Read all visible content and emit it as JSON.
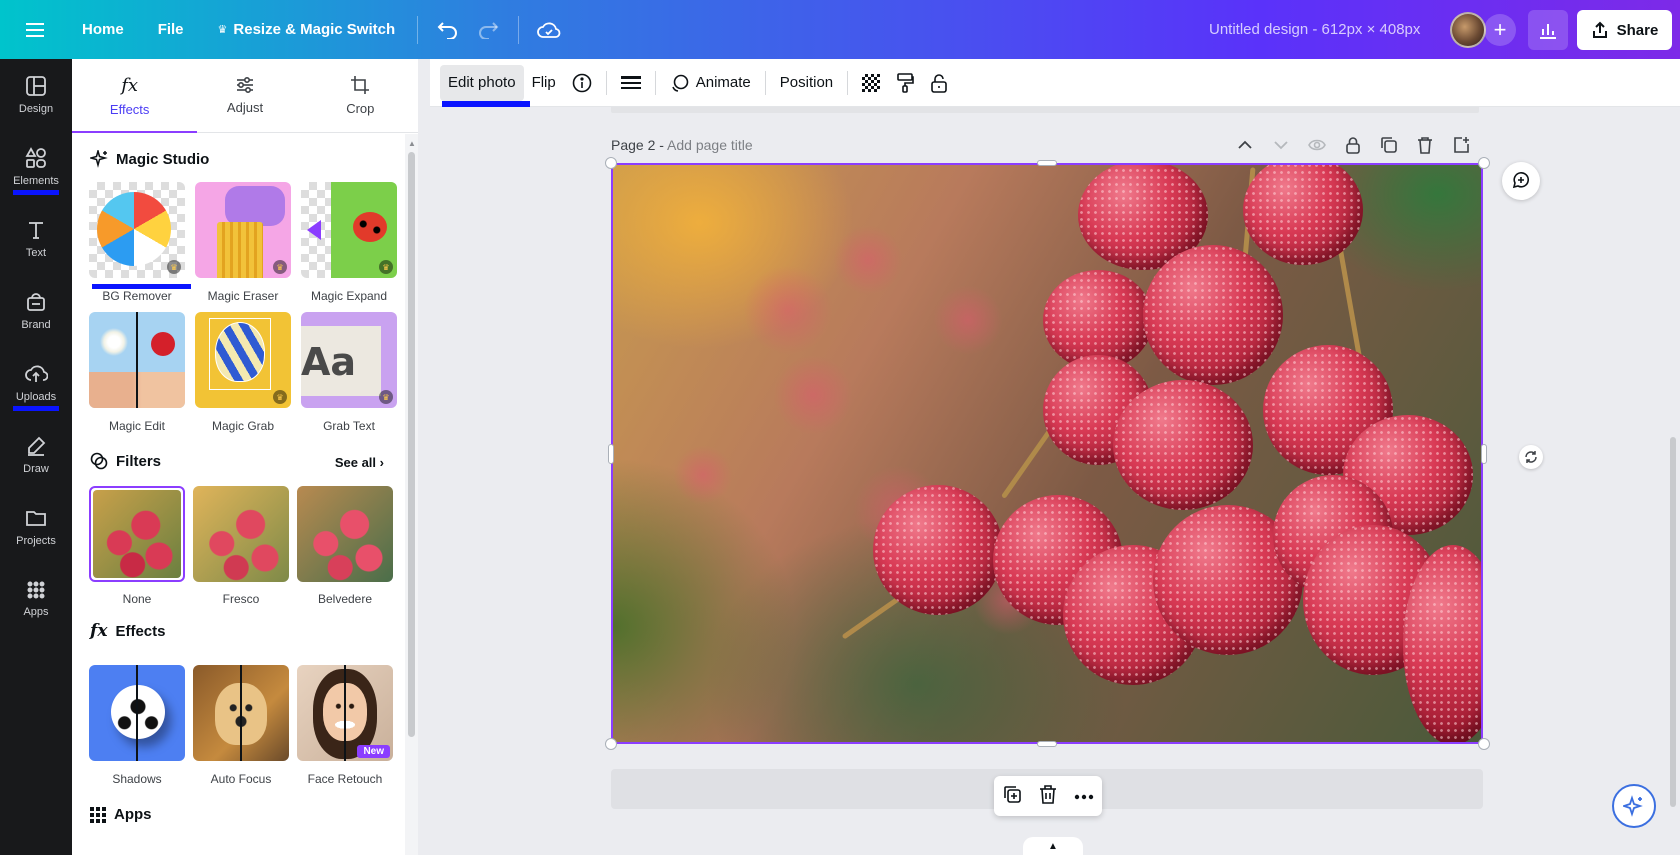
{
  "topbar": {
    "home": "Home",
    "file": "File",
    "resize": "Resize & Magic Switch",
    "design_title": "Untitled design - 612px × 408px",
    "share": "Share"
  },
  "rail": {
    "items": [
      {
        "label": "Design",
        "icon": "layout-icon"
      },
      {
        "label": "Elements",
        "icon": "shapes-icon"
      },
      {
        "label": "Text",
        "icon": "text-icon"
      },
      {
        "label": "Brand",
        "icon": "brand-icon"
      },
      {
        "label": "Uploads",
        "icon": "cloud-upload-icon"
      },
      {
        "label": "Draw",
        "icon": "pen-icon"
      },
      {
        "label": "Projects",
        "icon": "folder-icon"
      },
      {
        "label": "Apps",
        "icon": "grid-icon"
      }
    ]
  },
  "panel": {
    "tabs": [
      {
        "label": "Effects",
        "icon": "fx-icon"
      },
      {
        "label": "Adjust",
        "icon": "sliders-icon"
      },
      {
        "label": "Crop",
        "icon": "crop-icon"
      }
    ],
    "magic_studio": {
      "title": "Magic Studio",
      "tools": [
        {
          "label": "BG Remover"
        },
        {
          "label": "Magic Eraser"
        },
        {
          "label": "Magic Expand"
        },
        {
          "label": "Magic Edit"
        },
        {
          "label": "Magic Grab"
        },
        {
          "label": "Grab Text"
        }
      ]
    },
    "filters": {
      "title": "Filters",
      "see_all": "See all",
      "items": [
        {
          "label": "None"
        },
        {
          "label": "Fresco"
        },
        {
          "label": "Belvedere"
        }
      ]
    },
    "effects": {
      "title": "Effects",
      "items": [
        {
          "label": "Shadows"
        },
        {
          "label": "Auto Focus"
        },
        {
          "label": "Face Retouch",
          "badge": "New"
        }
      ]
    },
    "apps": {
      "title": "Apps"
    }
  },
  "toolbar": {
    "edit_photo": "Edit photo",
    "flip": "Flip",
    "animate": "Animate",
    "position": "Position"
  },
  "canvas": {
    "page_label": "Page 2 - ",
    "page_title_placeholder": "Add page title"
  },
  "colors": {
    "accent": "#8b3dff",
    "selection_marker": "#0a14ff"
  }
}
